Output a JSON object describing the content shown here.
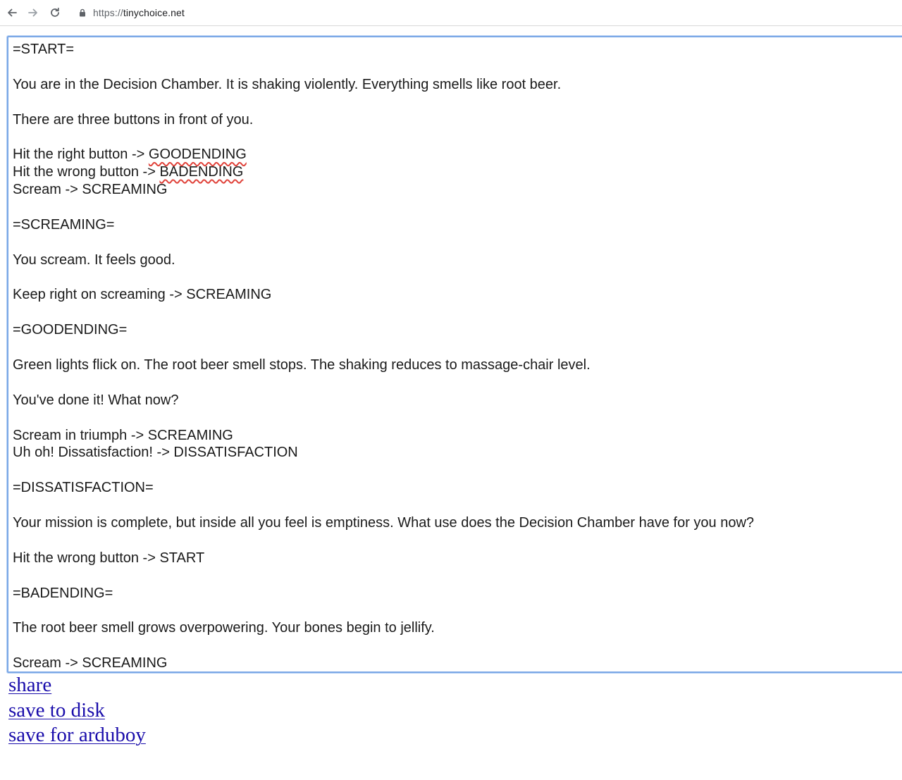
{
  "browser": {
    "url_scheme": "https://",
    "url_host": "tinychoice.net",
    "icons": {
      "back": "back-arrow-icon",
      "forward": "forward-arrow-icon",
      "reload": "reload-icon",
      "secure": "lock-icon"
    }
  },
  "editor": {
    "lines": [
      "=START=",
      "",
      "You are in the Decision Chamber. It is shaking violently. Everything smells like root beer.",
      "",
      "There are three buttons in front of you.",
      "",
      "Hit the right button -> GOODENDING",
      "Hit the wrong button -> BADENDING",
      "Scream -> SCREAMING",
      "",
      "=SCREAMING=",
      "",
      "You scream. It feels good.",
      "",
      "Keep right on screaming -> SCREAMING",
      "",
      "=GOODENDING=",
      "",
      "Green lights flick on. The root beer smell stops. The shaking reduces to massage-chair level.",
      "",
      "You've done it! What now?",
      "",
      "Scream in triumph -> SCREAMING",
      "Uh oh! Dissatisfaction! -> DISSATISFACTION",
      "",
      "=DISSATISFACTION=",
      "",
      "Your mission is complete, but inside all you feel is emptiness. What use does the Decision Chamber have for you now?",
      "",
      "Hit the wrong button -> START",
      "",
      "=BADENDING=",
      "",
      "The root beer smell grows overpowering. Your bones begin to jellify.",
      "",
      "Scream -> SCREAMING"
    ],
    "spellcheck_flagged": [
      {
        "line": 6,
        "prefix": "Hit the right button -> ",
        "word": "GOODENDING"
      },
      {
        "line": 7,
        "prefix": "Hit the wrong button -> ",
        "word": "BADENDING"
      }
    ],
    "colors": {
      "focus_border": "#7aa7e6",
      "spellcheck_underline": "#e0433b"
    }
  },
  "links": [
    {
      "label": "share"
    },
    {
      "label": "save to disk"
    },
    {
      "label": "save for arduboy"
    }
  ],
  "colors": {
    "link": "#1a0dab",
    "text": "#1a1a1a"
  }
}
